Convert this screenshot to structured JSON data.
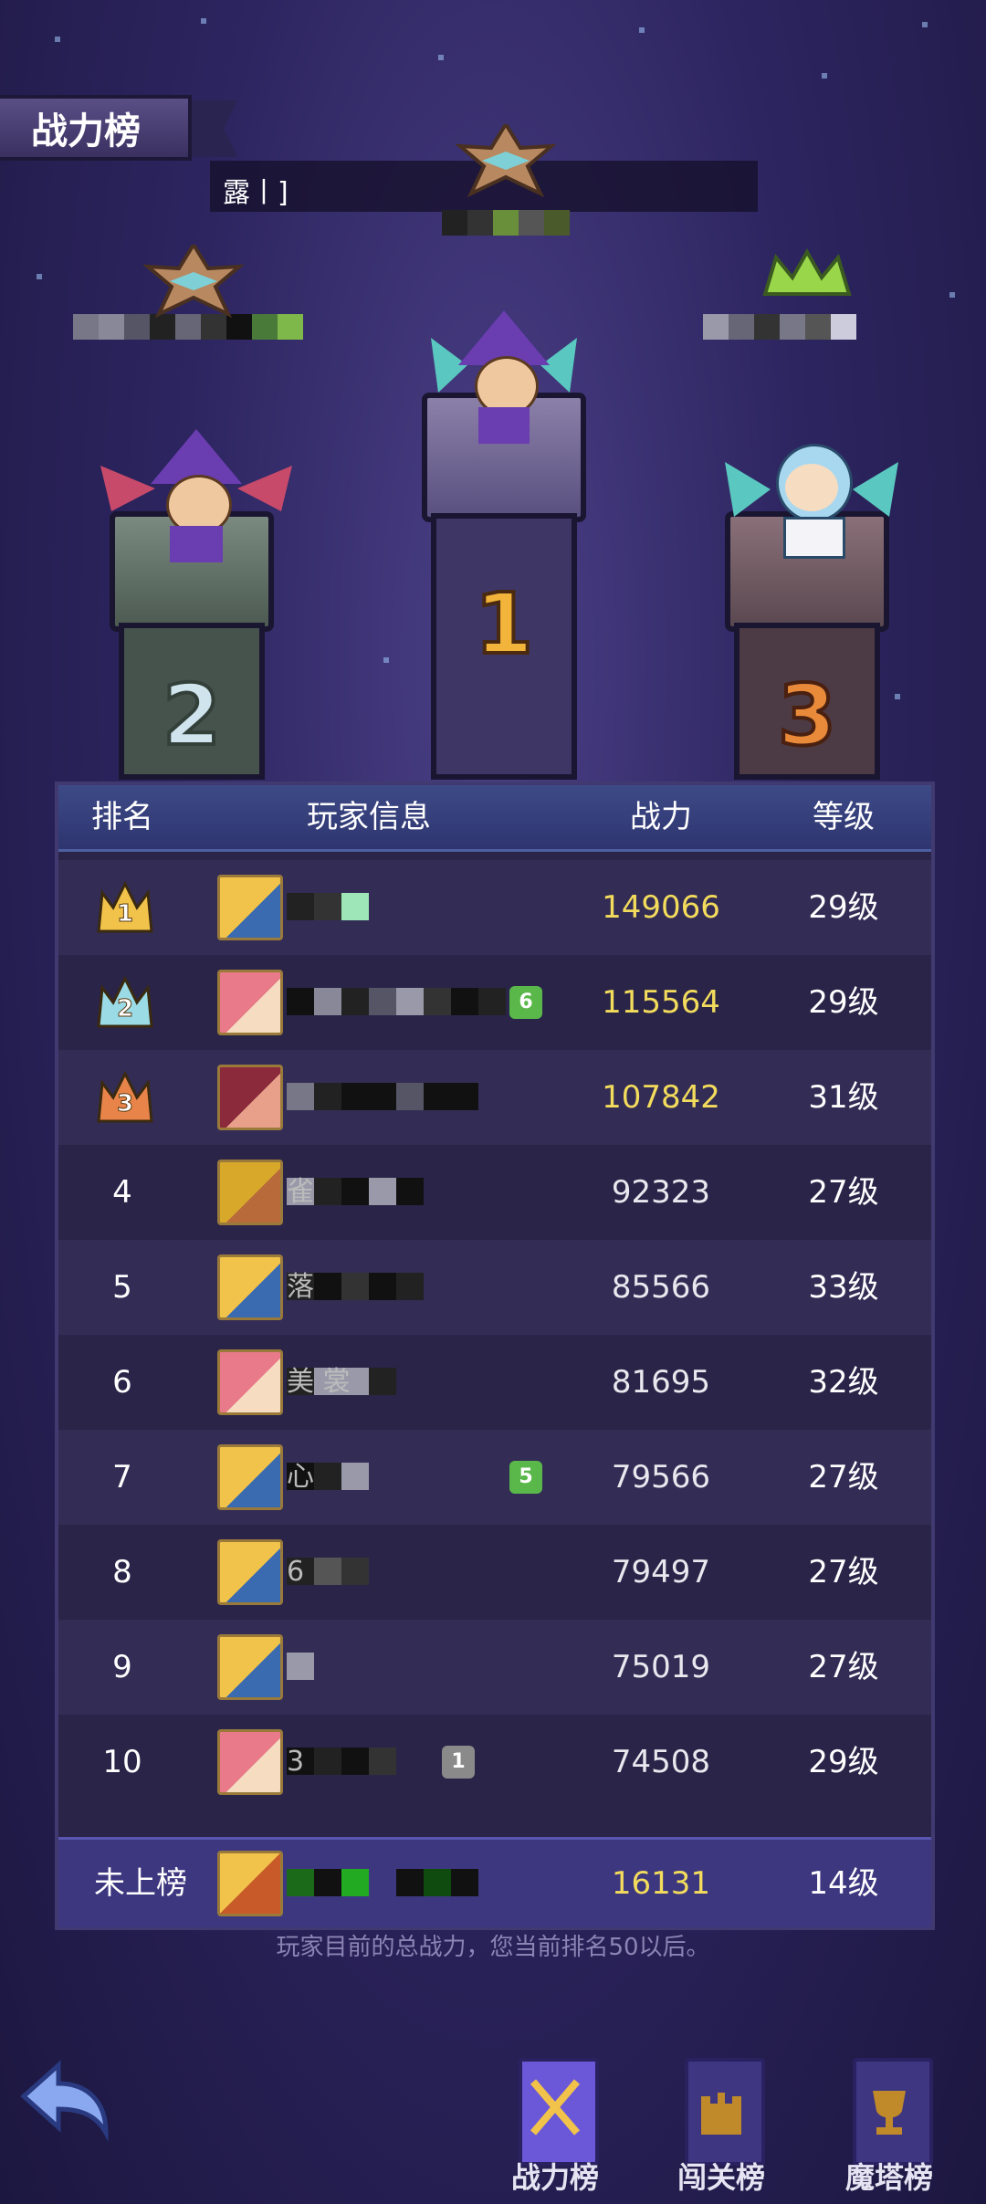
{
  "page_title": "战力榜",
  "podium": {
    "first_name_fragment": "露丨]",
    "ranks": [
      "1",
      "2",
      "3"
    ]
  },
  "table": {
    "headers": [
      "排名",
      "玩家信息",
      "战力",
      "等级"
    ],
    "rows": [
      {
        "rank": "1",
        "power": "149066",
        "level": "29级",
        "name_fragment": "",
        "badge": "",
        "avatar": "blond"
      },
      {
        "rank": "2",
        "power": "115564",
        "level": "29级",
        "name_fragment": "",
        "badge": "6",
        "avatar": "pink"
      },
      {
        "rank": "3",
        "power": "107842",
        "level": "31级",
        "name_fragment": "",
        "badge": "",
        "avatar": "red"
      },
      {
        "rank": "4",
        "power": "92323",
        "level": "27级",
        "name_fragment": "雀",
        "badge": "",
        "avatar": "gold"
      },
      {
        "rank": "5",
        "power": "85566",
        "level": "33级",
        "name_fragment": "落",
        "badge": "",
        "avatar": "blond"
      },
      {
        "rank": "6",
        "power": "81695",
        "level": "32级",
        "name_fragment": "美  裳",
        "badge": "",
        "avatar": "pink"
      },
      {
        "rank": "7",
        "power": "79566",
        "level": "27级",
        "name_fragment": "心",
        "badge": "5",
        "avatar": "blond"
      },
      {
        "rank": "8",
        "power": "79497",
        "level": "27级",
        "name_fragment": "6",
        "badge": "",
        "avatar": "blond"
      },
      {
        "rank": "9",
        "power": "75019",
        "level": "27级",
        "name_fragment": "",
        "badge": "",
        "avatar": "blond"
      },
      {
        "rank": "10",
        "power": "74508",
        "level": "29级",
        "name_fragment": "3",
        "badge": "1",
        "avatar": "pink"
      }
    ],
    "my_row": {
      "rank": "未上榜",
      "power": "16131",
      "level": "14级"
    }
  },
  "footer_note": "玩家目前的总战力，您当前排名50以后。",
  "nav": {
    "tabs": [
      {
        "label": "战力榜",
        "active": true
      },
      {
        "label": "闯关榜",
        "active": false
      },
      {
        "label": "魔塔榜",
        "active": false
      }
    ]
  },
  "colors": {
    "gold_power": "#f3dc5c",
    "header": "#2e3570",
    "my_row": "#3d3780"
  }
}
